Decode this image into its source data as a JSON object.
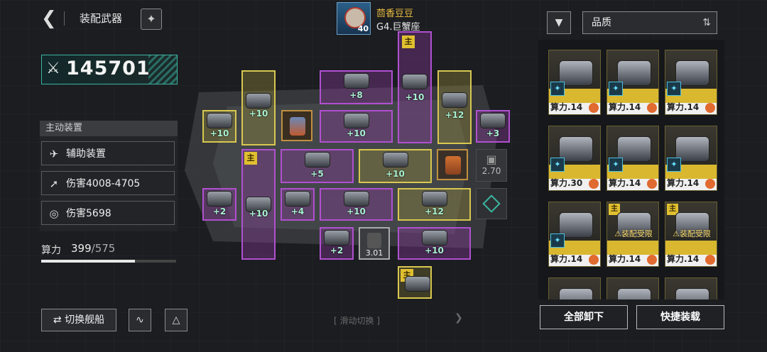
{
  "header": {
    "title": "装配武器",
    "back_icon": "back-arrow-icon",
    "skin_icon": "skin-icon"
  },
  "power": {
    "value": "145701",
    "icon": "crossed-swords-icon"
  },
  "devices": {
    "header": "主动装置",
    "items": [
      {
        "icon": "aux-device-icon",
        "label": "辅助装置"
      },
      {
        "icon": "missile-icon",
        "label": "伤害4008-4705"
      },
      {
        "icon": "target-icon",
        "label": "伤害5698"
      }
    ]
  },
  "calc_power": {
    "label": "算力",
    "current": "399",
    "max": "/575",
    "fill_ratio": 0.694
  },
  "bottom_left": {
    "switch_label": "切换舰船",
    "switch_icon": "swap-icon"
  },
  "commander": {
    "name": "茴香豆豆",
    "level": "40",
    "ship": "G4.巨蟹座"
  },
  "slots": {
    "main_tag": "主",
    "plus": [
      "+10",
      "+10",
      "+8",
      "+10",
      "+12",
      "+10",
      "+10",
      "+3",
      "+10",
      "+5",
      "+10",
      "+2",
      "+10",
      "+4",
      "+10",
      "+12",
      "+2",
      "+10"
    ],
    "locked_value": "2.70",
    "gray_value": "3.01"
  },
  "swipe": {
    "label": "滑动切换"
  },
  "right": {
    "sort_label": "品质",
    "cards": [
      {
        "calc": "算力.14"
      },
      {
        "calc": "算力.14"
      },
      {
        "calc": "算力.14"
      },
      {
        "calc": "算力.30"
      },
      {
        "calc": "算力.14"
      },
      {
        "calc": "算力.14"
      },
      {
        "calc": "算力.14"
      },
      {
        "calc": "算力.14",
        "limit": "装配受限",
        "tag": "主"
      },
      {
        "calc": "算力.14",
        "limit": "装配受限",
        "tag": "主"
      }
    ],
    "unload_all": "全部卸下",
    "quick_equip": "快捷装载"
  }
}
